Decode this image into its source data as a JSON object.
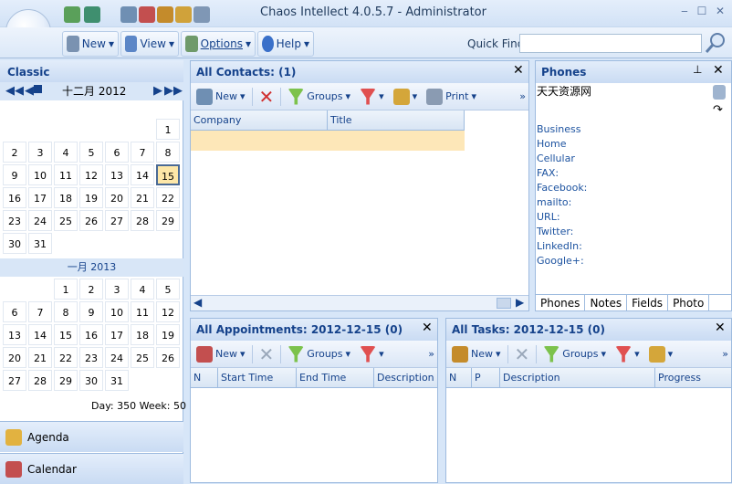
{
  "window": {
    "title": "Chaos Intellect 4.0.5.7  - Administrator"
  },
  "ribbon": {
    "new": "New",
    "view": "View",
    "options": "Options",
    "help": "Help",
    "quick_find_label": "Quick Find",
    "quick_find_value": ""
  },
  "left": {
    "header": "Classic",
    "month1": "十二月 2012",
    "month2": "一月 2013",
    "day_week": "Day: 350  Week: 50",
    "nav_agenda": "Agenda",
    "nav_calendar": "Calendar",
    "dec_days": [
      "1",
      "2",
      "3",
      "4",
      "5",
      "6",
      "7",
      "8",
      "9",
      "10",
      "11",
      "12",
      "13",
      "14",
      "15",
      "16",
      "17",
      "18",
      "19",
      "20",
      "21",
      "22",
      "23",
      "24",
      "25",
      "26",
      "27",
      "28",
      "29",
      "30",
      "31"
    ],
    "jan_days": [
      "1",
      "2",
      "3",
      "4",
      "5",
      "6",
      "7",
      "8",
      "9",
      "10",
      "11",
      "12",
      "13",
      "14",
      "15",
      "16",
      "17",
      "18",
      "19",
      "20",
      "21",
      "22",
      "23",
      "24",
      "25",
      "26",
      "27",
      "28",
      "29",
      "30",
      "31"
    ],
    "today": "15"
  },
  "contacts": {
    "title": "All Contacts:  (1)",
    "new": "New",
    "groups": "Groups",
    "print": "Print",
    "col_company": "Company",
    "col_title": "Title"
  },
  "phones": {
    "title": "Phones",
    "name": "天天资源网",
    "fields": [
      "Business",
      "Home",
      "Cellular",
      "FAX:",
      "Facebook:",
      "mailto:",
      "URL:",
      "Twitter:",
      "LinkedIn:",
      "Google+:"
    ],
    "tabs": [
      "Phones",
      "Notes",
      "Fields",
      "Photo"
    ]
  },
  "appointments": {
    "title": "All Appointments: 2012-12-15  (0)",
    "new": "New",
    "groups": "Groups",
    "cols": [
      "N",
      "Start Time",
      "End Time",
      "Description"
    ]
  },
  "tasks": {
    "title": "All Tasks: 2012-12-15  (0)",
    "new": "New",
    "groups": "Groups",
    "cols": [
      "N",
      "P",
      "Description",
      "Progress"
    ]
  }
}
